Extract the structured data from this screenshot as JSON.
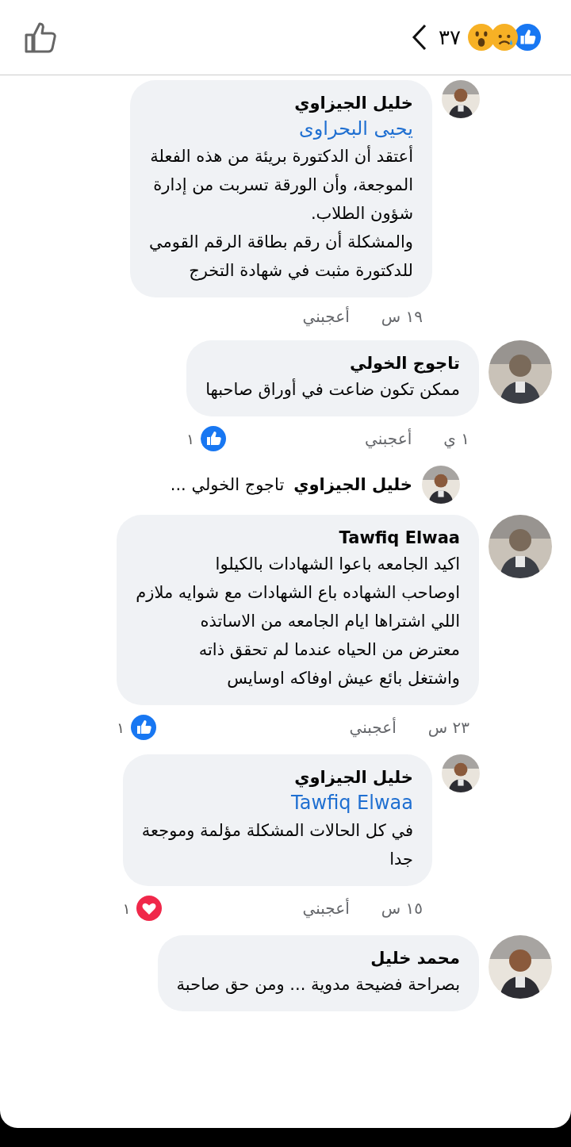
{
  "header": {
    "reactions": [
      {
        "kind": "like"
      },
      {
        "kind": "sad"
      },
      {
        "kind": "wow"
      }
    ],
    "count": "٣٧"
  },
  "comments": [
    {
      "kind": "reply",
      "author": "خليل الجيزاوي",
      "mention": "يحيى البحراوى",
      "text": "أعتقد أن الدكتورة بريئة من هذه الفعلة\nالموجعة، وأن الورقة تسربت من إدارة\nشؤون الطلاب.\n والمشكلة أن رقم بطاقة الرقم القومي\nللدكتورة مثبت في شهادة التخرج",
      "time": "١٩ س",
      "like_label": "أعجبني"
    },
    {
      "kind": "comment",
      "author": "تاجوج الخولي",
      "text": "ممكن تكون ضاعت في أوراق صاحبها",
      "time": "١ ي",
      "like_label": "أعجبني",
      "reaction": {
        "kind": "like",
        "count": "١"
      },
      "children": [
        {
          "kind": "preview",
          "author": "خليل الجيزاوي",
          "text": "تاجوج الخولي ..."
        }
      ]
    },
    {
      "kind": "comment",
      "author": "Tawfiq Elwaa",
      "text": "اكيد الجامعه باعوا الشهادات بالكيلوا\nاوصاحب الشهاده باع الشهادات مع شوايه ملازم\nاللي اشتراها ايام الجامعه من الاساتذه\nمعترض من الحياه عندما لم تحقق ذاته\nواشتغل بائع عيش اوفاكه اوسايس",
      "time": "٢٣ س",
      "like_label": "أعجبني",
      "reaction": {
        "kind": "like",
        "count": "١"
      },
      "children": [
        {
          "kind": "reply",
          "author": "خليل الجيزاوي",
          "mention": "Tawfiq Elwaa",
          "text": "في كل الحالات المشكلة مؤلمة وموجعة\nجدا",
          "time": "١٥ س",
          "like_label": "أعجبني",
          "reaction": {
            "kind": "love",
            "count": "١"
          }
        }
      ]
    },
    {
      "kind": "comment",
      "author": "محمد خليل",
      "text": "بصراحة فضيحة مدوية ... ومن حق صاحبة"
    }
  ]
}
